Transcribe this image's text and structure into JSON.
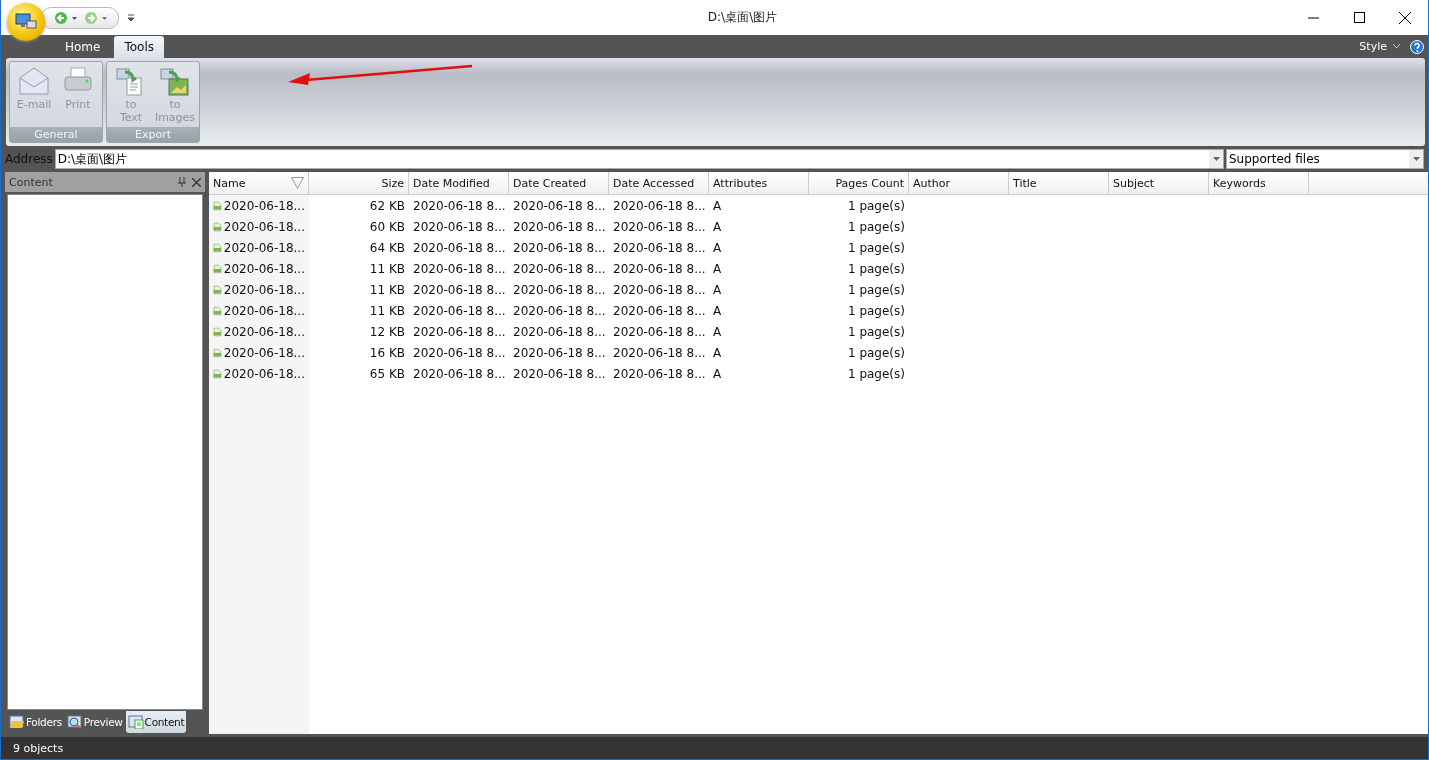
{
  "window": {
    "title": "D:\\桌面\\图片"
  },
  "tabs": [
    {
      "label": "Home",
      "selected": false
    },
    {
      "label": "Tools",
      "selected": true
    }
  ],
  "style_menu": "Style",
  "ribbon_groups": [
    {
      "label": "General",
      "buttons": [
        {
          "kind": "email",
          "label": "E-mail",
          "disabled": true
        },
        {
          "kind": "print",
          "label": "Print",
          "disabled": true
        }
      ]
    },
    {
      "label": "Export",
      "buttons": [
        {
          "kind": "text",
          "label": "to\nText",
          "disabled": true
        },
        {
          "kind": "images",
          "label": "to\nImages",
          "disabled": true
        }
      ]
    }
  ],
  "address": {
    "label": "Address",
    "value": "D:\\桌面\\图片",
    "filter": "Supported files"
  },
  "side_panel": {
    "title": "Content",
    "tabs": [
      {
        "kind": "folders",
        "label": "Folders",
        "selected": false
      },
      {
        "kind": "preview",
        "label": "Preview",
        "selected": false
      },
      {
        "kind": "content",
        "label": "Content",
        "selected": true
      }
    ]
  },
  "table": {
    "columns": [
      {
        "label": "Name",
        "kind": "text"
      },
      {
        "label": "Size",
        "kind": "numeric"
      },
      {
        "label": "Date Modified",
        "kind": "text"
      },
      {
        "label": "Date Created",
        "kind": "text"
      },
      {
        "label": "Date Accessed",
        "kind": "text"
      },
      {
        "label": "Attributes",
        "kind": "text"
      },
      {
        "label": "Pages Count",
        "kind": "numeric"
      },
      {
        "label": "Author",
        "kind": "text"
      },
      {
        "label": "Title",
        "kind": "text"
      },
      {
        "label": "Subject",
        "kind": "text"
      },
      {
        "label": "Keywords",
        "kind": "text"
      }
    ],
    "rows": [
      [
        "2020-06-18...",
        "62 KB",
        "2020-06-18 8...",
        "2020-06-18 8...",
        "2020-06-18 8...",
        "A",
        "1 page(s)"
      ],
      [
        "2020-06-18...",
        "60 KB",
        "2020-06-18 8...",
        "2020-06-18 8...",
        "2020-06-18 8...",
        "A",
        "1 page(s)"
      ],
      [
        "2020-06-18...",
        "64 KB",
        "2020-06-18 8...",
        "2020-06-18 8...",
        "2020-06-18 8...",
        "A",
        "1 page(s)"
      ],
      [
        "2020-06-18...",
        "11 KB",
        "2020-06-18 8...",
        "2020-06-18 8...",
        "2020-06-18 8...",
        "A",
        "1 page(s)"
      ],
      [
        "2020-06-18...",
        "11 KB",
        "2020-06-18 8...",
        "2020-06-18 8...",
        "2020-06-18 8...",
        "A",
        "1 page(s)"
      ],
      [
        "2020-06-18...",
        "11 KB",
        "2020-06-18 8...",
        "2020-06-18 8...",
        "2020-06-18 8...",
        "A",
        "1 page(s)"
      ],
      [
        "2020-06-18...",
        "12 KB",
        "2020-06-18 8...",
        "2020-06-18 8...",
        "2020-06-18 8...",
        "A",
        "1 page(s)"
      ],
      [
        "2020-06-18...",
        "16 KB",
        "2020-06-18 8...",
        "2020-06-18 8...",
        "2020-06-18 8...",
        "A",
        "1 page(s)"
      ],
      [
        "2020-06-18...",
        "65 KB",
        "2020-06-18 8...",
        "2020-06-18 8...",
        "2020-06-18 8...",
        "A",
        "1 page(s)"
      ]
    ]
  },
  "status_bar": "9 objects"
}
